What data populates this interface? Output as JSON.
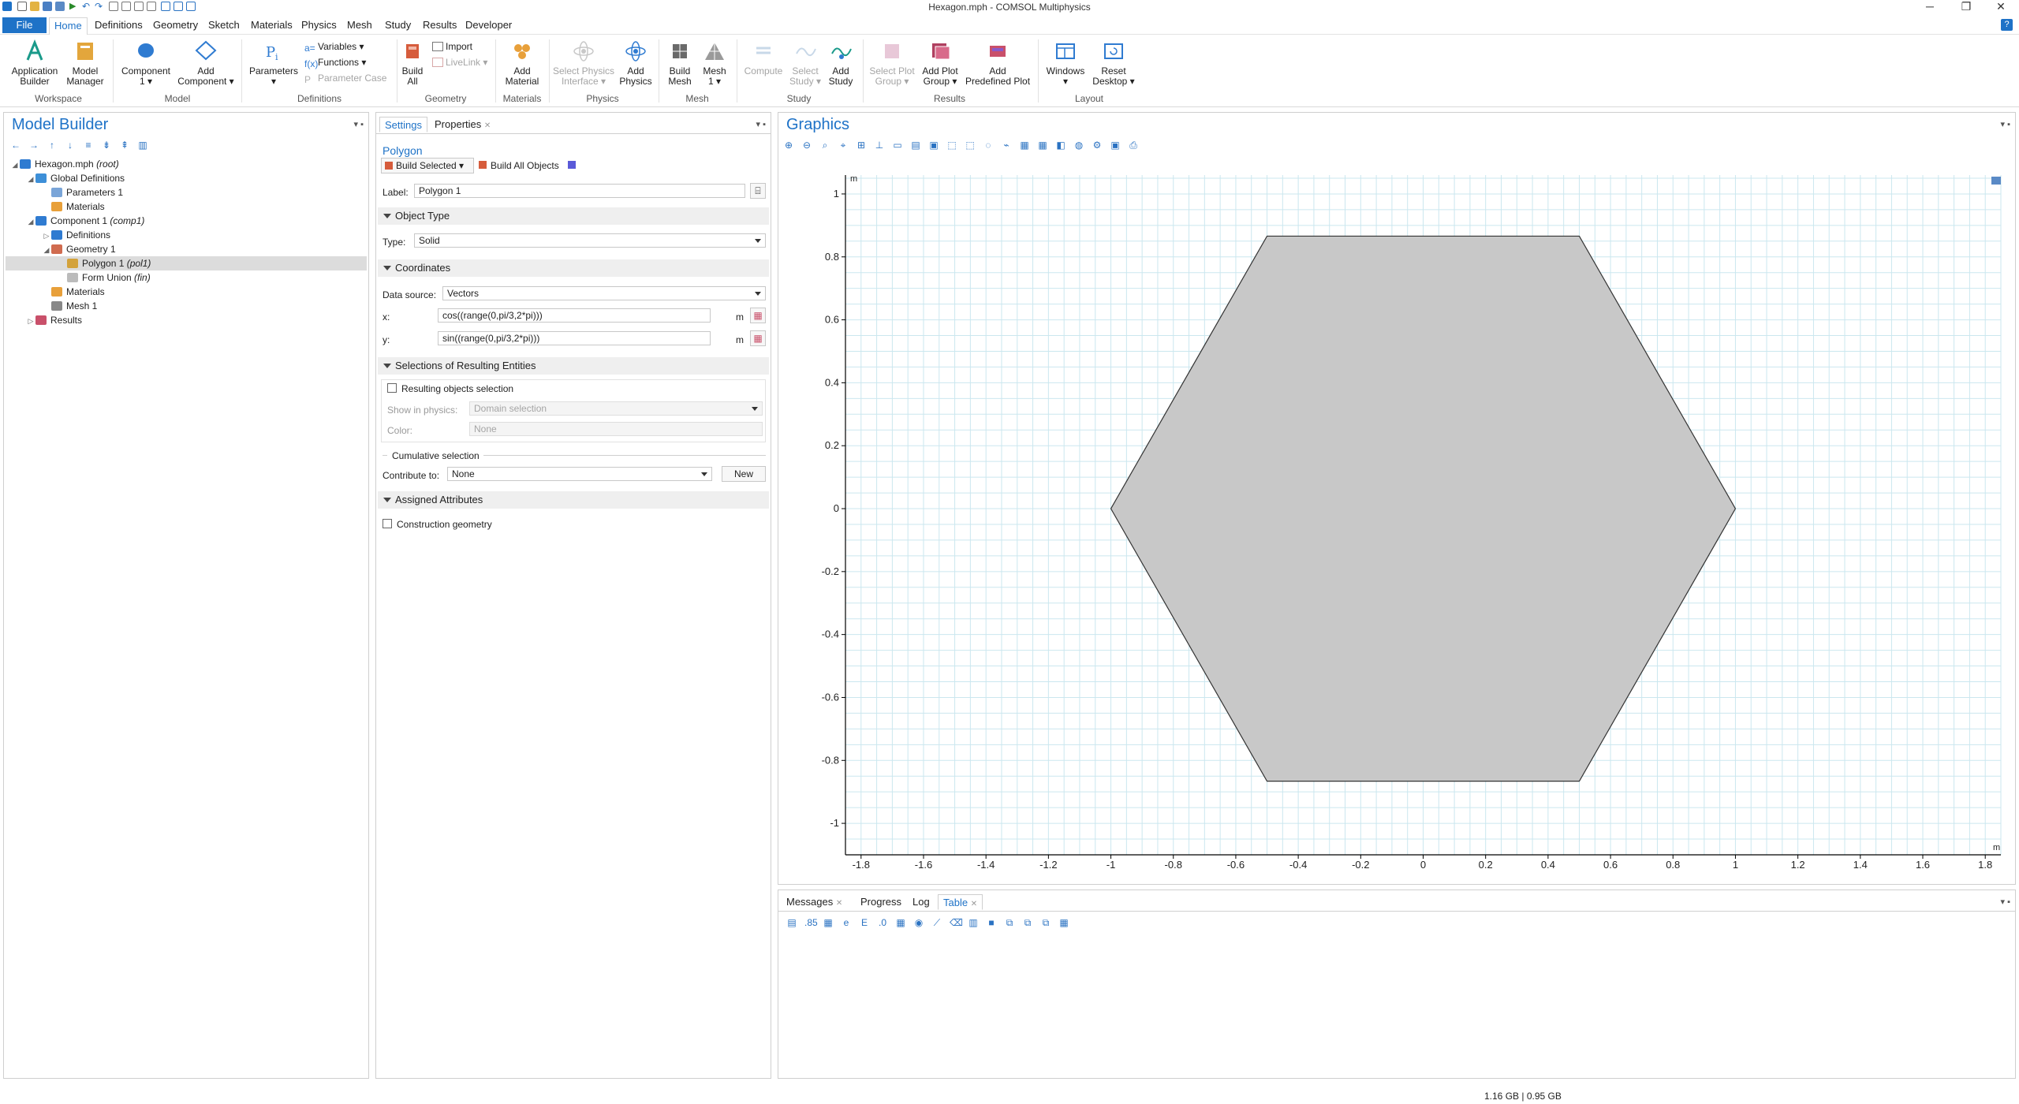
{
  "window": {
    "title": "Hexagon.mph - COMSOL Multiphysics",
    "minimize": "─",
    "restore": "❐",
    "close": "✕"
  },
  "menu": {
    "file": "File",
    "tabs": [
      "Home",
      "Definitions",
      "Geometry",
      "Sketch",
      "Materials",
      "Physics",
      "Mesh",
      "Study",
      "Results",
      "Developer"
    ],
    "active_tab": "Home",
    "help": "?"
  },
  "ribbon": {
    "groups": [
      "Workspace",
      "Model",
      "Definitions",
      "Geometry",
      "Materials",
      "Physics",
      "Mesh",
      "Study",
      "Results",
      "Layout"
    ],
    "buttons": {
      "app_builder": [
        "Application",
        "Builder"
      ],
      "model_manager": [
        "Model",
        "Manager"
      ],
      "component": [
        "Component",
        "1 ▾"
      ],
      "add_component": [
        "Add",
        "Component ▾"
      ],
      "parameters": [
        "Parameters",
        "▾"
      ],
      "variables": "Variables ▾",
      "functions": "Functions ▾",
      "parameter_case": "Parameter Case",
      "build_all": [
        "Build",
        "All"
      ],
      "import": "Import",
      "livelink": "LiveLink ▾",
      "add_material": [
        "Add",
        "Material"
      ],
      "select_physics": [
        "Select Physics",
        "Interface ▾"
      ],
      "add_physics": [
        "Add",
        "Physics"
      ],
      "build_mesh": [
        "Build",
        "Mesh"
      ],
      "mesh1": [
        "Mesh",
        "1 ▾"
      ],
      "compute": [
        "Compute",
        ""
      ],
      "select_study": [
        "Select",
        "Study ▾"
      ],
      "add_study": [
        "Add",
        "Study"
      ],
      "select_plot_group": [
        "Select Plot",
        "Group ▾"
      ],
      "add_plot_group": [
        "Add Plot",
        "Group ▾"
      ],
      "add_predefined_plot": [
        "Add",
        "Predefined Plot"
      ],
      "windows": [
        "Windows",
        "▾"
      ],
      "reset_desktop": [
        "Reset",
        "Desktop ▾"
      ]
    }
  },
  "model_builder": {
    "title": "Model Builder",
    "tree": [
      {
        "label": "Hexagon.mph",
        "tag": "(root)",
        "indent": 0,
        "toggle": "◢",
        "color": "#2f7bd1"
      },
      {
        "label": "Global Definitions",
        "tag": "",
        "indent": 1,
        "toggle": "◢",
        "color": "#3d8fd8"
      },
      {
        "label": "Parameters 1",
        "tag": "",
        "indent": 2,
        "toggle": "",
        "color": "#7aa5d8"
      },
      {
        "label": "Materials",
        "tag": "",
        "indent": 2,
        "toggle": "",
        "color": "#e8a03a"
      },
      {
        "label": "Component 1",
        "tag": "(comp1)",
        "indent": 1,
        "toggle": "◢",
        "color": "#2f7bd1"
      },
      {
        "label": "Definitions",
        "tag": "",
        "indent": 2,
        "toggle": "▷",
        "color": "#2f7bd1"
      },
      {
        "label": "Geometry 1",
        "tag": "",
        "indent": 2,
        "toggle": "◢",
        "color": "#d06b4f"
      },
      {
        "label": "Polygon 1",
        "tag": "(pol1)",
        "indent": 3,
        "toggle": "",
        "color": "#d3a23b",
        "selected": true
      },
      {
        "label": "Form Union",
        "tag": "(fin)",
        "indent": 3,
        "toggle": "",
        "color": "#bbbbbb"
      },
      {
        "label": "Materials",
        "tag": "",
        "indent": 2,
        "toggle": "",
        "color": "#e8a03a"
      },
      {
        "label": "Mesh 1",
        "tag": "",
        "indent": 2,
        "toggle": "",
        "color": "#888888"
      },
      {
        "label": "Results",
        "tag": "",
        "indent": 1,
        "toggle": "▷",
        "color": "#c9506a"
      }
    ]
  },
  "settings": {
    "tabs": [
      "Settings",
      "Properties"
    ],
    "node_type": "Polygon",
    "build_selected": "Build Selected",
    "build_all_objects": "Build All Objects",
    "label_caption": "Label:",
    "label_value": "Polygon 1",
    "sections": {
      "object_type": "Object Type",
      "coordinates": "Coordinates",
      "selections": "Selections of Resulting Entities",
      "cumulative": "Cumulative selection",
      "assigned": "Assigned Attributes"
    },
    "type_caption": "Type:",
    "type_value": "Solid",
    "data_source_caption": "Data source:",
    "data_source_value": "Vectors",
    "x_caption": "x:",
    "x_value": "cos((range(0,pi/3,2*pi)))",
    "y_caption": "y:",
    "y_value": "sin((range(0,pi/3,2*pi)))",
    "unit": "m",
    "resulting_objects": "Resulting objects selection",
    "show_in_physics_caption": "Show in physics:",
    "show_in_physics_value": "Domain selection",
    "color_caption": "Color:",
    "color_value": "None",
    "contribute_caption": "Contribute to:",
    "contribute_value": "None",
    "new_button": "New",
    "construction_geometry": "Construction geometry"
  },
  "graphics": {
    "title": "Graphics",
    "unit_label": "m",
    "x_ticks": [
      "-1.8",
      "-1.6",
      "-1.4",
      "-1.2",
      "-1",
      "-0.8",
      "-0.6",
      "-0.4",
      "-0.2",
      "0",
      "0.2",
      "0.4",
      "0.6",
      "0.8",
      "1",
      "1.2",
      "1.4",
      "1.6",
      "1.8"
    ],
    "y_ticks": [
      "1",
      "0.8",
      "0.6",
      "0.4",
      "0.2",
      "0",
      "-0.2",
      "-0.4",
      "-0.6",
      "-0.8",
      "-1"
    ],
    "fill": "#c8c8c8",
    "grid_color": "#cbe7ef"
  },
  "chart_data": {
    "type": "scatter",
    "title": "",
    "xlabel": "m",
    "ylabel": "m",
    "xlim": [
      -1.85,
      1.85
    ],
    "ylim": [
      -1.1,
      1.06
    ],
    "grid": true,
    "polygon": {
      "x": [
        1,
        0.5,
        -0.5,
        -1,
        -0.5,
        0.5
      ],
      "y": [
        0,
        0.866,
        0.866,
        0,
        -0.866,
        -0.866
      ]
    }
  },
  "bottom": {
    "tabs": [
      "Messages",
      "Progress",
      "Log",
      "Table"
    ],
    "active": "Table"
  },
  "status": {
    "memory": "1.16 GB | 0.95 GB"
  }
}
